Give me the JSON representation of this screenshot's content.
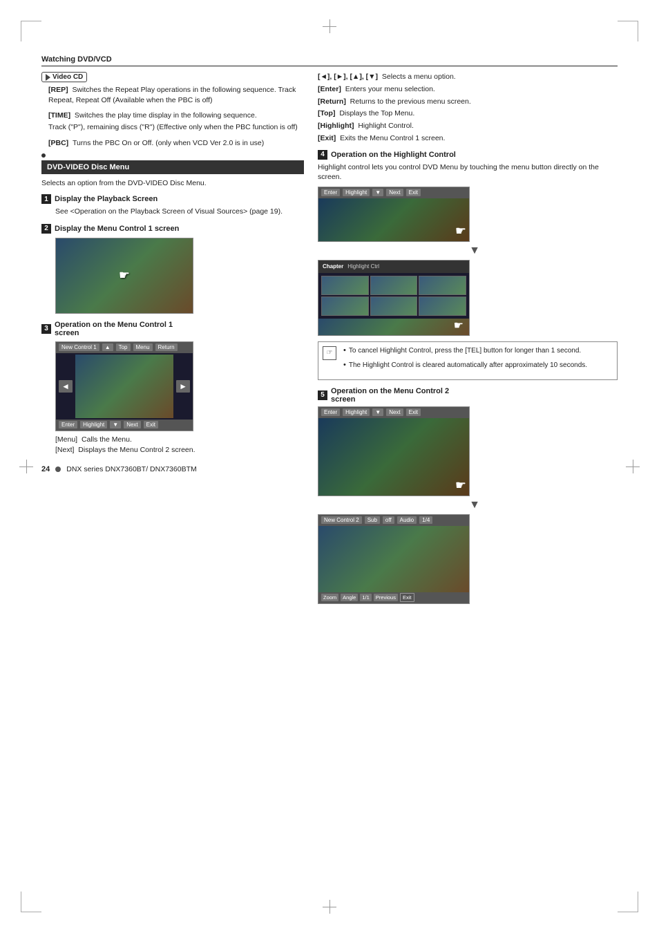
{
  "page": {
    "section": "Watching DVD/VCD",
    "footer_page": "24",
    "footer_circle": "●",
    "footer_text": "DNX series  DNX7360BT/ DNX7360BTM"
  },
  "video_cd": {
    "icon_label": "Video CD",
    "rep_label": "[REP]",
    "rep_text": "Switches the Repeat Play operations in the following sequence. Track Repeat, Repeat Off (Available when the PBC is off)",
    "time_label": "[TIME]",
    "time_text": "Switches the play time display in the following sequence.",
    "time_text2": "Track (\"P\"), remaining discs (\"R\") (Effective only when the PBC function is off)",
    "pbc_label": "[PBC]",
    "pbc_text": "Turns the PBC On or Off. (only when VCD Ver 2.0 is in use)"
  },
  "dvd_menu": {
    "title": "DVD-VIDEO Disc Menu",
    "desc": "Selects an option from the DVD-VIDEO Disc Menu.",
    "section1_num": "1",
    "section1_title": "Display the Playback Screen",
    "section1_text": "See <Operation on the Playback Screen of Visual Sources> (page 19).",
    "section2_num": "2",
    "section2_title": "Display the Menu Control 1 screen",
    "section3_num": "3",
    "section3_title": "Operation on the Menu Control 1 screen",
    "menu_label": "[Menu]",
    "menu_desc": "Calls the Menu.",
    "next_label": "[Next]",
    "next_desc": "Displays the Menu Control 2 screen."
  },
  "right_col": {
    "arrows_text": "[◄], [►], [▲], [▼]",
    "arrows_desc": "Selects a menu option.",
    "enter_label": "[Enter]",
    "enter_desc": "Enters your menu selection.",
    "return_label": "[Return]",
    "return_desc": "Returns to the previous menu screen.",
    "top_label": "[Top]",
    "top_desc": "Displays the Top Menu.",
    "highlight_label": "[Highlight]",
    "highlight_desc": "Highlight Control.",
    "exit_label": "[Exit]",
    "exit_desc": "Exits the Menu Control 1 screen.",
    "section4_num": "4",
    "section4_title": "Operation on the Highlight Control",
    "section4_desc": "Highlight control lets you control DVD Menu by touching the menu button directly on the screen.",
    "note_icon": "☞",
    "note1": "To cancel Highlight Control, press the [TEL] button for longer than 1 second.",
    "note2": "The Highlight Control is cleared automatically after approximately 10 seconds.",
    "section5_num": "5",
    "section5_title": "Operation on the Menu Control 2 screen"
  },
  "screen_labels": {
    "menu_control1_top": [
      "New Control 1",
      "▲",
      "Top",
      "Menu",
      "Return"
    ],
    "menu_control1_left": "◄",
    "menu_control1_right": "►",
    "menu_control1_bottom": [
      "Enter",
      "Highlight",
      "▼",
      "Next",
      "Exit"
    ],
    "highlight_top": [
      "Enter",
      "Highlight",
      "▼",
      "Next",
      "Exit"
    ],
    "chapter_title": "Chapter",
    "chapter_sub": "Highlight Ctrl",
    "menu2_top": [
      "Enter",
      "Highlight",
      "▼",
      "Next",
      "Exit"
    ],
    "menu2_bottom_row": [
      "New Control 2",
      "Sub",
      "off",
      "Audio",
      "1/4"
    ],
    "menu2_nav": [
      "Zoom",
      "Angle",
      "1/1",
      "Previous",
      "Exit"
    ]
  }
}
